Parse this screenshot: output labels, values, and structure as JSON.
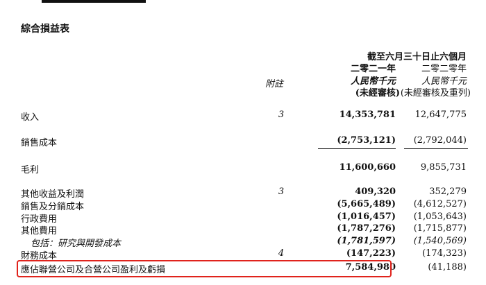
{
  "title": "綜合損益表",
  "header": {
    "period": "截至六月三十日止六個月",
    "note_col": "附註",
    "col2021": {
      "year": "二零二一年",
      "unit": "人民幣千元",
      "status": "(未經審核)"
    },
    "col2020": {
      "year": "二零二零年",
      "unit": "人民幣千元",
      "status": "(未經審核及重列)"
    }
  },
  "rows": [
    {
      "label": "收入",
      "note": "3",
      "v2021": "14,353,781",
      "v2020": "12,647,775"
    },
    {
      "label": "銷售成本",
      "note": "",
      "v2021": "(2,753,121)",
      "v2020": "(2,792,044)"
    },
    {
      "label": "毛利",
      "note": "",
      "v2021": "11,600,660",
      "v2020": "9,855,731"
    },
    {
      "label": "其他收益及利潤",
      "note": "3",
      "v2021": "409,320",
      "v2020": "352,279"
    },
    {
      "label": "銷售及分銷成本",
      "note": "",
      "v2021": "(5,665,489)",
      "v2020": "(4,612,527)"
    },
    {
      "label": "行政費用",
      "note": "",
      "v2021": "(1,016,457)",
      "v2020": "(1,053,643)"
    },
    {
      "label": "其他費用",
      "note": "",
      "v2021": "(1,787,276)",
      "v2020": "(1,715,877)"
    },
    {
      "label": "包括：研究與開發成本",
      "note": "",
      "v2021": "(1,781,597)",
      "v2020": "(1,540,569)"
    },
    {
      "label": "財務成本",
      "note": "4",
      "v2021": "(147,223)",
      "v2020": "(174,323)"
    },
    {
      "label": "應佔聯營公司及合營公司盈利及虧損",
      "note": "",
      "v2021": "7,584,980",
      "v2020": "(41,188)"
    }
  ],
  "highlight_color": "#e0231c"
}
